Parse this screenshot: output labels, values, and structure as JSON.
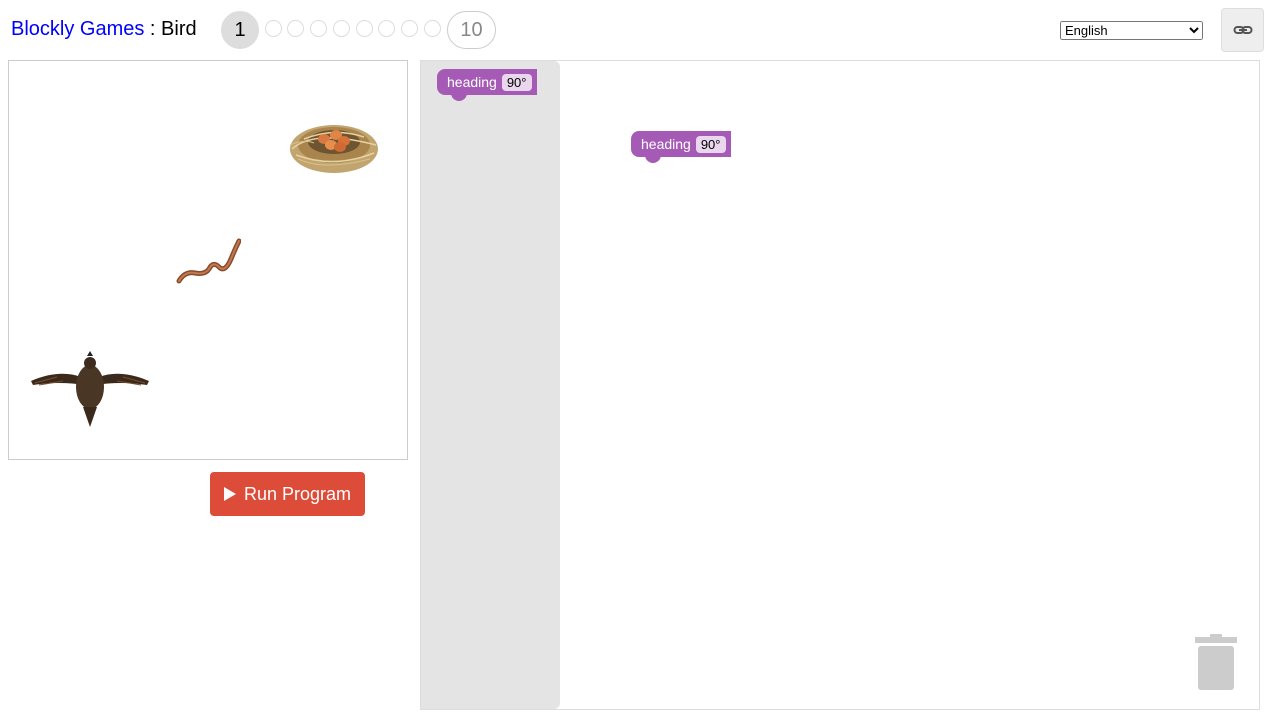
{
  "header": {
    "app_link": "Blockly Games",
    "separator": " : ",
    "game": "Bird",
    "levels": {
      "current": "1",
      "last": "10"
    }
  },
  "language": {
    "selected": "English"
  },
  "link_button": {
    "icon": "link-icon"
  },
  "visualization": {
    "items": [
      "nest-image",
      "worm-image",
      "bird-image"
    ]
  },
  "run_button": {
    "label": "Run Program",
    "icon": "play-icon"
  },
  "flyout": {
    "blocks": [
      {
        "label": "heading",
        "value": "90°"
      }
    ]
  },
  "workspace": {
    "blocks": [
      {
        "label": "heading",
        "value": "90°"
      }
    ]
  },
  "trash": {
    "icon": "trash-icon"
  },
  "colors": {
    "link": "#0000ff",
    "run_button": "#dd4b39",
    "block": "#a55bb5",
    "flyout": "#e4e4e4"
  }
}
